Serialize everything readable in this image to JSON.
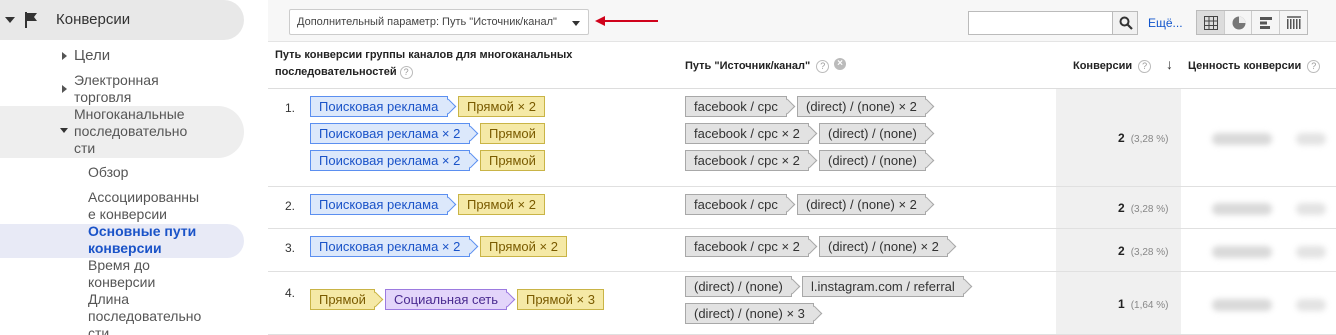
{
  "sidebar": {
    "section": "Конверсии",
    "goals": "Цели",
    "ecommerce_line1": "Электронная",
    "ecommerce_line2": "торговля",
    "mcf_line1": "Многоканальные",
    "mcf_line2": "последовательно",
    "mcf_line3": "сти",
    "overview": "Обзор",
    "assisted_line1": "Ассоциированны",
    "assisted_line2": "е конверсии",
    "top_paths_line1": "Основные пути",
    "top_paths_line2": "конверсии",
    "time_lag_line1": "Время до",
    "time_lag_line2": "конверсии",
    "path_length_line1": "Длина",
    "path_length_line2": "последовательно",
    "path_length_line3": "сти"
  },
  "toolbar": {
    "secondary_dimension": "Дополнительный параметр: Путь \"Источник/канал\"",
    "more_label": "Ещё...",
    "search_value": ""
  },
  "table": {
    "col_path_line1": "Путь конверсии группы каналов для многоканальных",
    "col_path_line2": "последовательностей",
    "col_source": "Путь \"Источник/канал\"",
    "col_conversions": "Конверсии",
    "col_value": "Ценность конверсии",
    "rows": [
      {
        "num": "1.",
        "paths": [
          [
            "Поисковая реклама",
            "Прямой × 2"
          ],
          [
            "Поисковая реклама × 2",
            "Прямой"
          ],
          [
            "Поисковая реклама × 2",
            "Прямой"
          ]
        ],
        "sources": [
          [
            "facebook / cpc",
            "(direct) / (none) × 2"
          ],
          [
            "facebook / cpc × 2",
            "(direct) / (none)"
          ],
          [
            "facebook / cpc × 2",
            "(direct) / (none)"
          ]
        ],
        "conversions": "2",
        "pct": "(3,28 %)"
      },
      {
        "num": "2.",
        "paths": [
          [
            "Поисковая реклама",
            "Прямой × 2"
          ]
        ],
        "sources": [
          [
            "facebook / cpc",
            "(direct) / (none) × 2"
          ]
        ],
        "conversions": "2",
        "pct": "(3,28 %)"
      },
      {
        "num": "3.",
        "paths": [
          [
            "Поисковая реклама × 2",
            "Прямой × 2"
          ]
        ],
        "sources": [
          [
            "facebook / cpc × 2",
            "(direct) / (none) × 2"
          ]
        ],
        "conversions": "2",
        "pct": "(3,28 %)"
      },
      {
        "num": "4.",
        "paths": [
          [
            "Прямой",
            "Социальная сеть",
            "Прямой × 3"
          ]
        ],
        "sources": [
          [
            "(direct) / (none)",
            "l.instagram.com / referral"
          ],
          [
            "(direct) / (none) × 3"
          ]
        ],
        "conversions": "1",
        "pct": "(1,64 %)"
      }
    ]
  },
  "colors": {
    "paid_search": "#dce8fb",
    "direct": "#f5e9a6",
    "social": "#e3d5fa",
    "source": "#e2e2e2",
    "arrow": "#d0021b"
  }
}
